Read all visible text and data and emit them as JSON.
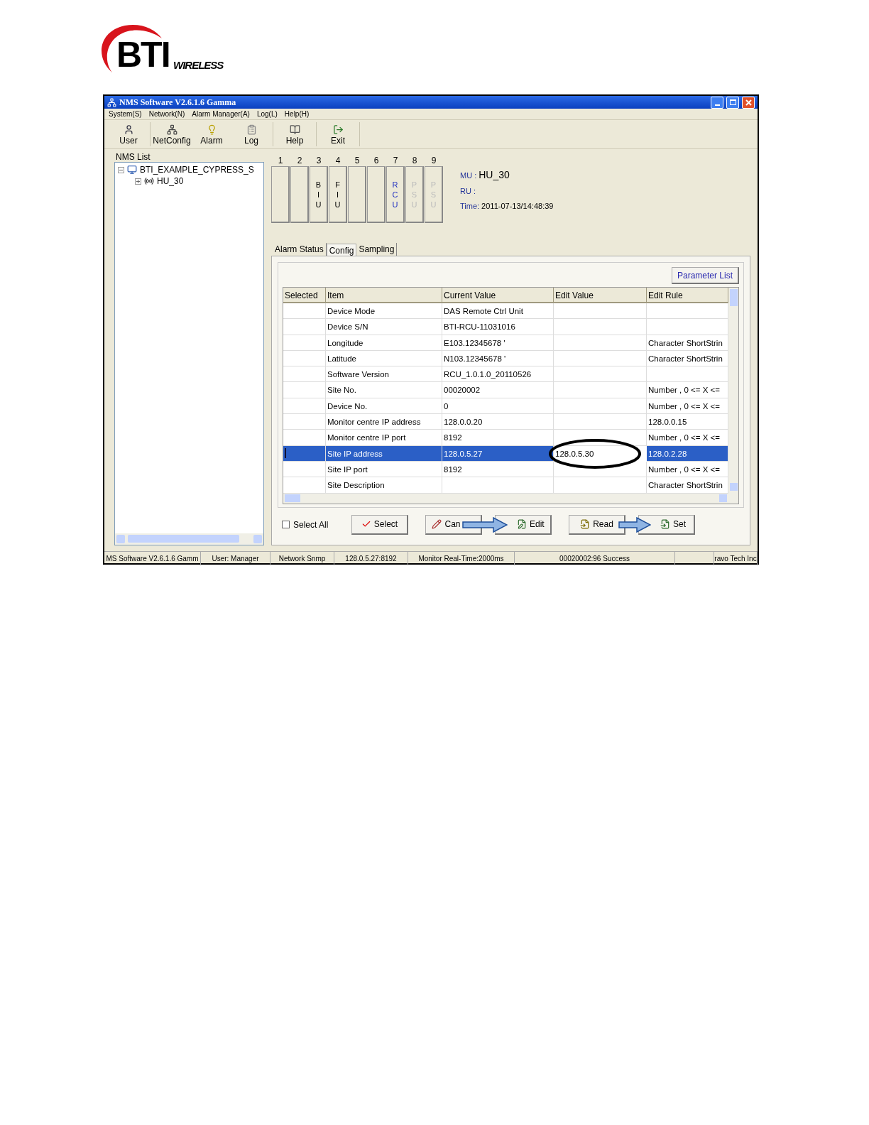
{
  "logo": {
    "mark": "BTI",
    "word": "WIRELESS"
  },
  "window": {
    "title": "NMS Software V2.6.1.6 Gamma"
  },
  "menu": [
    "System(S)",
    "Network(N)",
    "Alarm Manager(A)",
    "Log(L)",
    "Help(H)"
  ],
  "toolbar": [
    {
      "kind": "user",
      "label": "User"
    },
    {
      "kind": "network",
      "label": "NetConfig"
    },
    {
      "kind": "alarm",
      "label": "Alarm"
    },
    {
      "kind": "log",
      "label": "Log"
    },
    {
      "kind": "help",
      "label": "Help"
    },
    {
      "kind": "exit",
      "label": "Exit"
    }
  ],
  "nms_list": {
    "title": "NMS List",
    "tree": [
      {
        "label": "BTI_EXAMPLE_CYPRESS_S",
        "expanded": true,
        "children": [
          {
            "label": "HU_30",
            "expanded": false
          }
        ]
      }
    ]
  },
  "slots": [
    {
      "number": "1"
    },
    {
      "number": "2"
    },
    {
      "number": "3",
      "letters": "BIU",
      "selected": false,
      "disabled": false
    },
    {
      "number": "4",
      "letters": "FIU",
      "selected": false,
      "disabled": false
    },
    {
      "number": "5"
    },
    {
      "number": "6"
    },
    {
      "number": "7",
      "letters": "RCU",
      "selected": true,
      "disabled": false
    },
    {
      "number": "8",
      "letters": "PSU",
      "selected": false,
      "disabled": true
    },
    {
      "number": "9",
      "letters": "PSU",
      "selected": false,
      "disabled": true
    }
  ],
  "info": [
    {
      "label": "MU :",
      "value": "HU_30"
    },
    {
      "label": "RU :"
    },
    {
      "label": "Time:",
      "value": "2011-07-13/14:48:39"
    }
  ],
  "tabs": [
    {
      "label": "Alarm Status",
      "selected": false
    },
    {
      "label": "Config",
      "selected": true
    },
    {
      "label": "Sampling",
      "selected": false
    }
  ],
  "parameter_list_button": "Parameter List",
  "table": {
    "columns": [
      "Selected",
      "Item",
      "Current Value",
      "Edit Value",
      "Edit Rule"
    ],
    "rows": [
      {
        "item": "Device Mode",
        "current": "DAS Remote Ctrl Unit",
        "selected": false
      },
      {
        "item": "Device S/N",
        "current": "BTI-RCU-11031016",
        "selected": false
      },
      {
        "item": "Longitude",
        "current": "E103.12345678 '",
        "rule": "Character ShortStrin",
        "selected": false
      },
      {
        "item": "Latitude",
        "current": "N103.12345678 '",
        "rule": "Character ShortStrin",
        "selected": false
      },
      {
        "item": "Software Version",
        "current": "RCU_1.0.1.0_20110526",
        "selected": false
      },
      {
        "item": "Site No.",
        "current": "00020002",
        "rule": "Number , 0 <= X <=",
        "selected": false
      },
      {
        "item": "Device No.",
        "current": "0",
        "rule": "Number , 0 <= X <=",
        "selected": false
      },
      {
        "item": "Monitor centre IP address",
        "current": "128.0.0.20",
        "rule": "128.0.0.15",
        "selected": false
      },
      {
        "item": "Monitor centre IP port",
        "current": "8192",
        "rule": "Number , 0 <= X <=",
        "selected": false
      },
      {
        "item": "Site IP address",
        "current": "128.0.5.27",
        "edit": "128.0.5.30",
        "rule": "128.0.2.28",
        "selected": true
      },
      {
        "item": "Site IP port",
        "current": "8192",
        "rule": "Number , 0 <= X <=",
        "selected": false
      },
      {
        "item": "Site Description",
        "rule": "Character ShortStrin",
        "selected": false
      }
    ]
  },
  "select_all": {
    "label": "Select All",
    "checked": false
  },
  "buttons": [
    {
      "kind": "select",
      "label": "Select"
    },
    {
      "kind": "cancel",
      "label": "Can"
    },
    {
      "kind": "edit",
      "label": "Edit"
    },
    {
      "kind": "read",
      "label": "Read"
    },
    {
      "kind": "set",
      "label": "Set"
    }
  ],
  "status_bar": [
    "MS Software V2.6.1.6 Gamm",
    "User: Manager",
    "Network Snmp",
    "128.0.5.27:8192",
    "Monitor Real-Time:2000ms",
    "00020002:96 Success",
    "ravo Tech Inc"
  ]
}
